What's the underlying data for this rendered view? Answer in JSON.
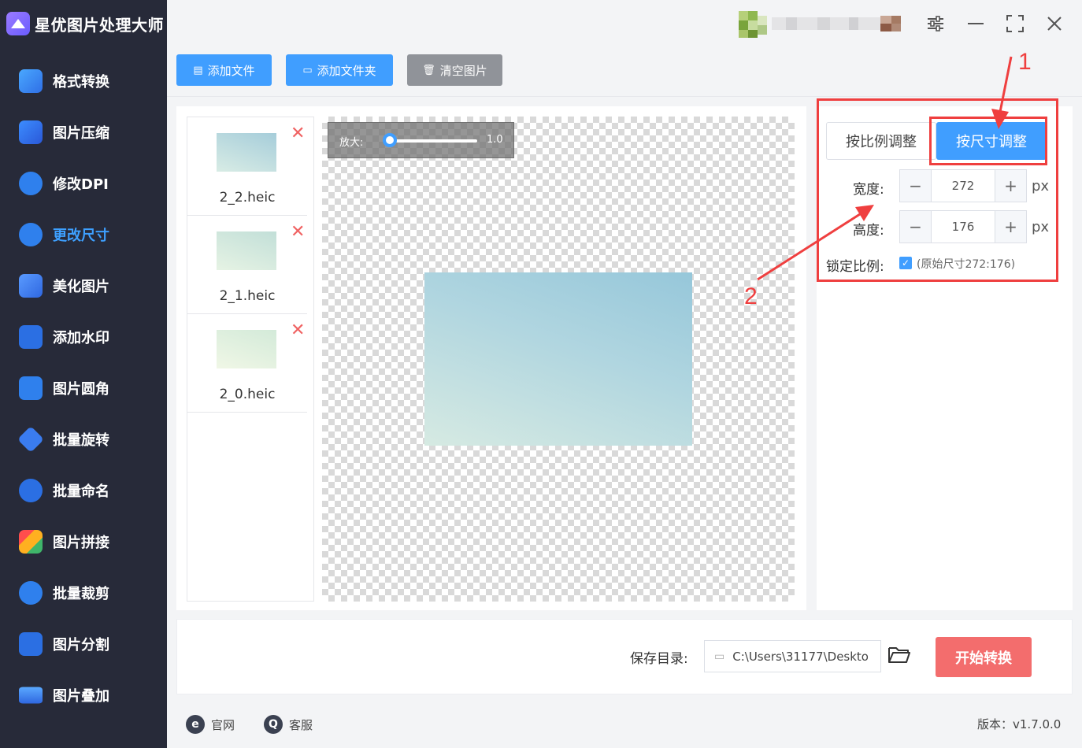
{
  "app": {
    "title": "星优图片处理大师"
  },
  "sidebar": {
    "items": [
      {
        "label": "格式转换",
        "icon": "format-convert-icon"
      },
      {
        "label": "图片压缩",
        "icon": "compress-icon"
      },
      {
        "label": "修改DPI",
        "icon": "dpi-icon"
      },
      {
        "label": "更改尺寸",
        "icon": "resize-icon",
        "active": true
      },
      {
        "label": "美化图片",
        "icon": "beautify-icon"
      },
      {
        "label": "添加水印",
        "icon": "watermark-icon"
      },
      {
        "label": "图片圆角",
        "icon": "rounded-corner-icon"
      },
      {
        "label": "批量旋转",
        "icon": "rotate-icon"
      },
      {
        "label": "批量命名",
        "icon": "rename-icon"
      },
      {
        "label": "图片拼接",
        "icon": "stitch-icon"
      },
      {
        "label": "批量裁剪",
        "icon": "crop-icon"
      },
      {
        "label": "图片分割",
        "icon": "split-icon"
      },
      {
        "label": "图片叠加",
        "icon": "overlay-icon"
      }
    ]
  },
  "toolbar": {
    "add_file": "添加文件",
    "add_folder": "添加文件夹",
    "clear": "清空图片"
  },
  "files": [
    {
      "name": "2_2.heic"
    },
    {
      "name": "2_1.heic"
    },
    {
      "name": "2_0.heic"
    }
  ],
  "preview": {
    "zoom_label": "放大:",
    "zoom_value": "1.0"
  },
  "settings": {
    "mode_ratio": "按比例调整",
    "mode_size": "按尺寸调整",
    "width_label": "宽度:",
    "width_value": "272",
    "height_label": "高度:",
    "height_value": "176",
    "unit": "px",
    "lock_label": "锁定比例:",
    "lock_checked": true,
    "lock_note": "(原始尺寸272:176)"
  },
  "save": {
    "label": "保存目录:",
    "path": "C:\\Users\\31177\\Deskto",
    "start_button": "开始转换"
  },
  "footer": {
    "website": "官网",
    "support": "客服",
    "version": "版本：v1.7.0.0"
  },
  "annotations": {
    "marker1": "1",
    "marker2": "2"
  },
  "colors": {
    "accent": "#409eff",
    "start": "#f36d6d",
    "sidebar": "#272a39",
    "annotation": "#ef3f3f"
  }
}
